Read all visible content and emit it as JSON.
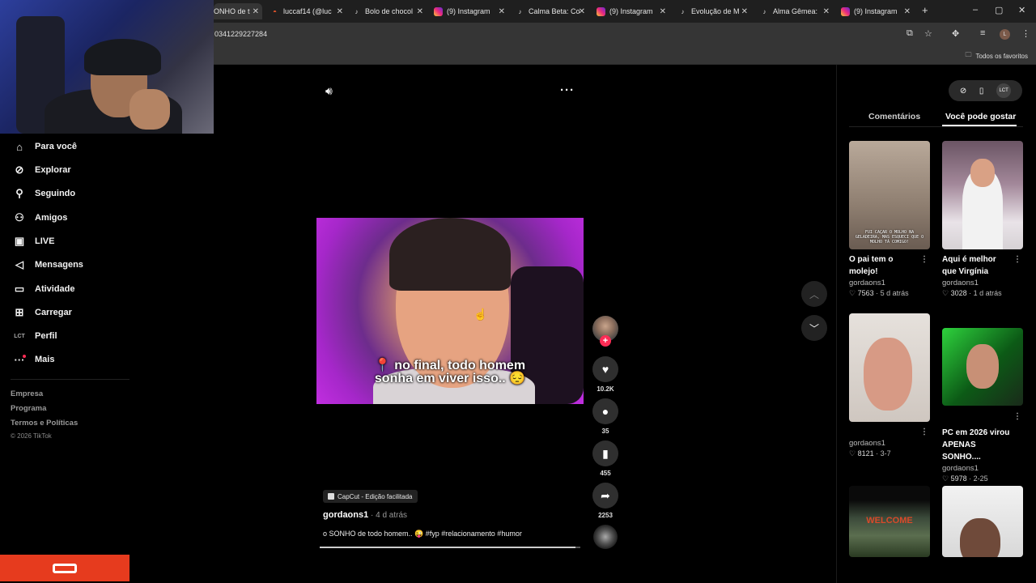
{
  "browser": {
    "tabs": [
      {
        "label": "ONHO de t",
        "icon": "tiktok-icon",
        "active": true
      },
      {
        "label": "luccaf14 (@luc",
        "icon": "kwai-icon"
      },
      {
        "label": "Bolo de chocol",
        "icon": "tiktok-icon"
      },
      {
        "label": "(9) Instagram",
        "icon": "instagram-icon"
      },
      {
        "label": "Calma Beta: Co",
        "icon": "tiktok-icon"
      },
      {
        "label": "(9) Instagram",
        "icon": "instagram-icon"
      },
      {
        "label": "Evolução de M",
        "icon": "tiktok-icon"
      },
      {
        "label": "Alma Gêmea:",
        "icon": "tiktok-icon"
      },
      {
        "label": "(9) Instagram",
        "icon": "instagram-icon"
      }
    ],
    "new_tab": "+",
    "url": "03412292272​84",
    "bookmarks_label": "Todos os favoritos",
    "profile_initial": "L"
  },
  "sidebar": {
    "items": [
      {
        "label": "Para você",
        "icon": "home-icon"
      },
      {
        "label": "Explorar",
        "icon": "compass-icon"
      },
      {
        "label": "Seguindo",
        "icon": "following-icon"
      },
      {
        "label": "Amigos",
        "icon": "friends-icon"
      },
      {
        "label": "LIVE",
        "icon": "live-icon"
      },
      {
        "label": "Mensagens",
        "icon": "messages-icon"
      },
      {
        "label": "Atividade",
        "icon": "activity-icon"
      },
      {
        "label": "Carregar",
        "icon": "upload-icon"
      },
      {
        "label": "Perfil",
        "icon": "profile-icon"
      },
      {
        "label": "Mais",
        "icon": "more-icon"
      }
    ],
    "footer": [
      "Empresa",
      "Programa",
      "Termos e Políticas"
    ],
    "copyright": "© 2026 TikTok"
  },
  "video": {
    "caption_line1": "📍 no final, todo homem",
    "caption_line2": "sonha em viver isso.. 😔",
    "likes": "10.2K",
    "comments": "35",
    "saves": "455",
    "shares": "2253",
    "capcut_label": "CapCut - Edição facilitada",
    "author": "gordaons1",
    "time": " · 4 d atrás",
    "description": "o SONHO de todo homem.. 😜 #fyp #relacionamento #humor",
    "progress": 0.98
  },
  "right_panel": {
    "tabs": [
      "Comentários",
      "Você pode gostar"
    ],
    "active_tab": "Você pode gostar",
    "cards": [
      {
        "title": "O pai tem o molejo!",
        "user": "gordaons1",
        "likes": "7563",
        "time": "5 d atrás",
        "thumb_text": "FUI CAÇAR O MOLHO NA GELADEIRA, MAS ESQUECI QUE O MOLHO TÁ COMIGO!"
      },
      {
        "title": "Aqui é melhor que Virgínia",
        "user": "gordaons1",
        "likes": "3028",
        "time": "1 d atrás",
        "thumb_text": ""
      },
      {
        "title": "",
        "user": "gordaons1",
        "likes": "8121",
        "time": "3-7",
        "thumb_text": ""
      },
      {
        "title": "PC em 2026 virou APENAS SONHO....",
        "user": "gordaons1",
        "likes": "5978",
        "time": "2-25",
        "thumb_text": ""
      },
      {
        "title": "",
        "user": "",
        "likes": "",
        "time": "",
        "thumb_text": "WELCOME"
      },
      {
        "title": "",
        "user": "",
        "likes": "",
        "time": "",
        "thumb_text": ""
      }
    ]
  }
}
